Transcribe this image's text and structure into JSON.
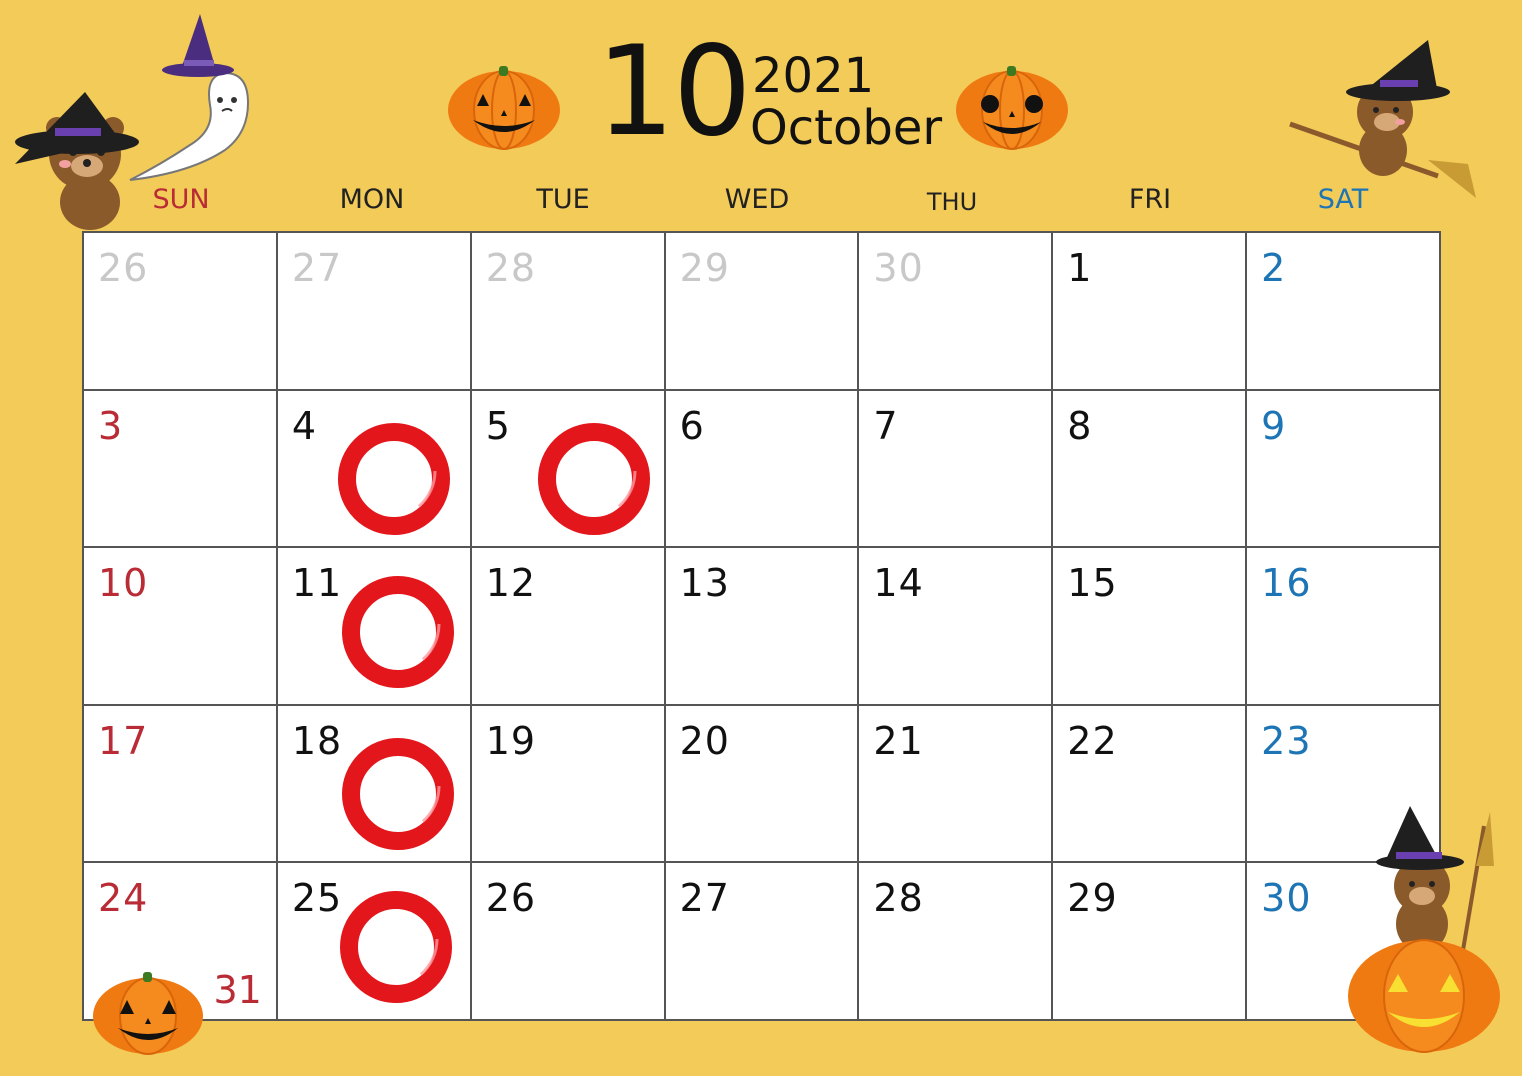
{
  "header": {
    "month_number": "10",
    "year": "2021",
    "month_name": "October"
  },
  "weekdays": [
    {
      "label": "SUN",
      "color": "#b92b35"
    },
    {
      "label": "MON",
      "color": "#222222"
    },
    {
      "label": "TUE",
      "color": "#222222"
    },
    {
      "label": "WED",
      "color": "#222222"
    },
    {
      "label": "THU",
      "color": "#222222"
    },
    {
      "label": "FRI",
      "color": "#222222"
    },
    {
      "label": "SAT",
      "color": "#1d75b5"
    }
  ],
  "weeks": [
    [
      {
        "day": "26",
        "kind": "other"
      },
      {
        "day": "27",
        "kind": "other"
      },
      {
        "day": "28",
        "kind": "other"
      },
      {
        "day": "29",
        "kind": "other"
      },
      {
        "day": "30",
        "kind": "other"
      },
      {
        "day": "1",
        "kind": "weekday"
      },
      {
        "day": "2",
        "kind": "sat"
      }
    ],
    [
      {
        "day": "3",
        "kind": "sun"
      },
      {
        "day": "4",
        "kind": "weekday",
        "marked": true
      },
      {
        "day": "5",
        "kind": "weekday",
        "marked": true
      },
      {
        "day": "6",
        "kind": "weekday"
      },
      {
        "day": "7",
        "kind": "weekday"
      },
      {
        "day": "8",
        "kind": "weekday"
      },
      {
        "day": "9",
        "kind": "sat"
      }
    ],
    [
      {
        "day": "10",
        "kind": "sun"
      },
      {
        "day": "11",
        "kind": "weekday",
        "marked": true
      },
      {
        "day": "12",
        "kind": "weekday"
      },
      {
        "day": "13",
        "kind": "weekday"
      },
      {
        "day": "14",
        "kind": "weekday"
      },
      {
        "day": "15",
        "kind": "weekday"
      },
      {
        "day": "16",
        "kind": "sat"
      }
    ],
    [
      {
        "day": "17",
        "kind": "sun"
      },
      {
        "day": "18",
        "kind": "weekday",
        "marked": true
      },
      {
        "day": "19",
        "kind": "weekday"
      },
      {
        "day": "20",
        "kind": "weekday"
      },
      {
        "day": "21",
        "kind": "weekday"
      },
      {
        "day": "22",
        "kind": "weekday"
      },
      {
        "day": "23",
        "kind": "sat"
      }
    ],
    [
      {
        "day": "24",
        "kind": "sun",
        "extra": "31"
      },
      {
        "day": "25",
        "kind": "weekday",
        "marked": true
      },
      {
        "day": "26",
        "kind": "weekday"
      },
      {
        "day": "27",
        "kind": "weekday"
      },
      {
        "day": "28",
        "kind": "weekday"
      },
      {
        "day": "29",
        "kind": "weekday"
      },
      {
        "day": "30",
        "kind": "sat"
      }
    ]
  ],
  "mark_icon": "red-circle-icon",
  "colors": {
    "background": "#f2cb58",
    "sunday": "#b92b35",
    "saturday": "#1d75b5",
    "other_month": "#c8c8c8",
    "mark": "#e3161b",
    "pumpkin": "#f07a12"
  },
  "decorations": [
    "jack-o-lantern-icon",
    "witch-bear-icon",
    "ghost-icon",
    "witch-bear-on-broom-icon",
    "bear-on-pumpkin-icon"
  ]
}
